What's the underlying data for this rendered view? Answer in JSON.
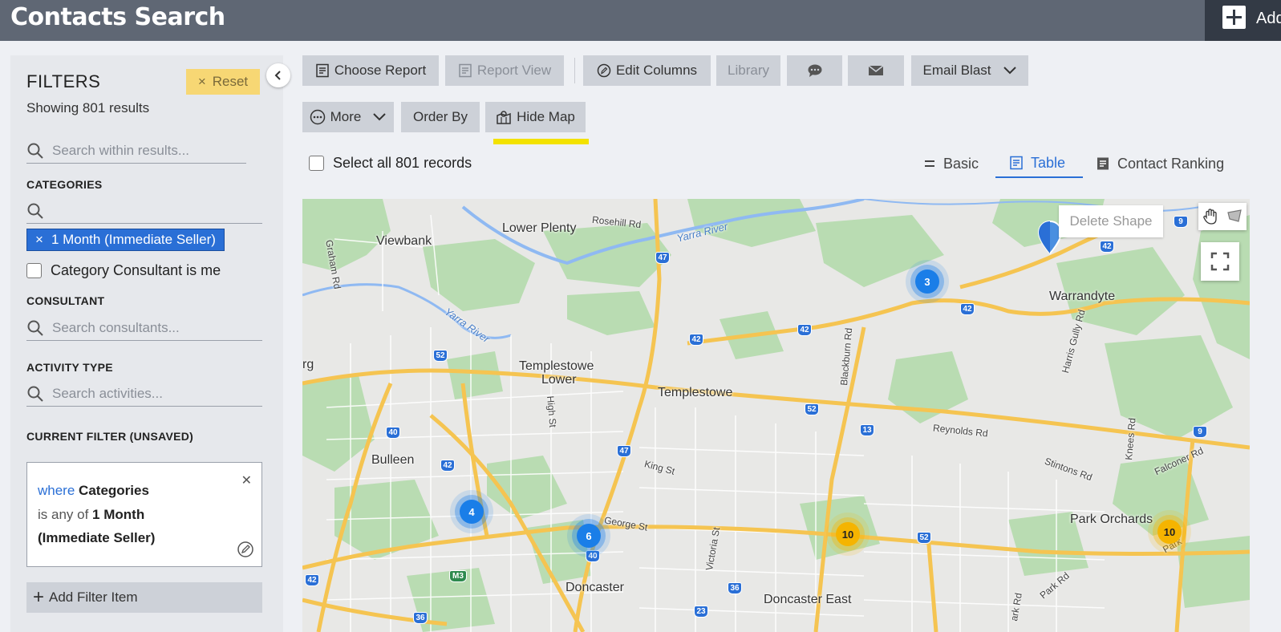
{
  "header": {
    "title": "Contacts Search",
    "add_label": "Add"
  },
  "sidebar": {
    "filters_title": "FILTERS",
    "reset_label": "Reset",
    "showing": "Showing 801 results",
    "search_placeholder": "Search within results...",
    "categories_label": "CATEGORIES",
    "category_chip": "1 Month (Immediate Seller)",
    "category_consultant_label": "Category Consultant is me",
    "consultant_label": "CONSULTANT",
    "consultant_placeholder": "Search consultants...",
    "activity_label": "ACTIVITY TYPE",
    "activity_placeholder": "Search activities...",
    "current_filter_label": "CURRENT FILTER (UNSAVED)",
    "filter_card": {
      "where": "where",
      "field": "Categories",
      "operator": "is any of",
      "value_line1": "1 Month",
      "value_line2": "(Immediate Seller)"
    },
    "add_filter_label": "Add Filter Item"
  },
  "toolbar": {
    "choose_report": "Choose Report",
    "report_view": "Report View",
    "edit_columns": "Edit Columns",
    "library": "Library",
    "email_blast": "Email Blast",
    "more": "More",
    "order_by": "Order By",
    "hide_map": "Hide Map"
  },
  "select_all_label": "Select all 801 records",
  "view_tabs": {
    "basic": "Basic",
    "table": "Table",
    "ranking": "Contact Ranking"
  },
  "map": {
    "delete_shape": "Delete Shape",
    "places": {
      "lower_plenty": "Lower Plenty",
      "viewbank": "Viewbank",
      "templestowe_lower_1": "Templestowe",
      "templestowe_lower_2": "Lower",
      "templestowe": "Templestowe",
      "bulleen": "Bulleen",
      "doncaster": "Doncaster",
      "doncaster_east": "Doncaster East",
      "warrandyte": "Warrandyte",
      "park_orchards": "Park Orchards",
      "edge_rg": "rg"
    },
    "roads": {
      "rosehill": "Rosehill Rd",
      "graham": "Graham Rd",
      "yarra1": "Yarra River",
      "yarra2": "Yarra River",
      "high": "High St",
      "king": "King St",
      "george": "George St",
      "victoria": "Victoria St",
      "blackburn": "Blackburn Rd",
      "reynolds": "Reynolds Rd",
      "stintons": "Stintons Rd",
      "knees": "Knees Rd",
      "falconer": "Falconer Rd",
      "harris": "Harris Gully Rd",
      "park_rd": "Park Rd",
      "park_short": "Park",
      "ark_rd": "ark Rd"
    },
    "clusters": {
      "c3": "3",
      "c4": "4",
      "c6": "6",
      "c10a": "10",
      "c10b": "10"
    },
    "shields": {
      "s47a": "47",
      "s47b": "47",
      "s42a": "42",
      "s42b": "42",
      "s42c": "42",
      "s42d": "42",
      "s42e": "42",
      "s52a": "52",
      "s52b": "52",
      "s52c": "52",
      "s40a": "40",
      "s40b": "40",
      "s13": "13",
      "s9a": "9",
      "s9b": "9",
      "s36a": "36",
      "s36b": "36",
      "s23": "23",
      "s42f": "42",
      "sm3": "M3"
    }
  },
  "colors": {
    "topbar": "#5f6774",
    "accent": "#2a6fd6",
    "reset": "#f7d774",
    "highlight": "#f3e200"
  }
}
